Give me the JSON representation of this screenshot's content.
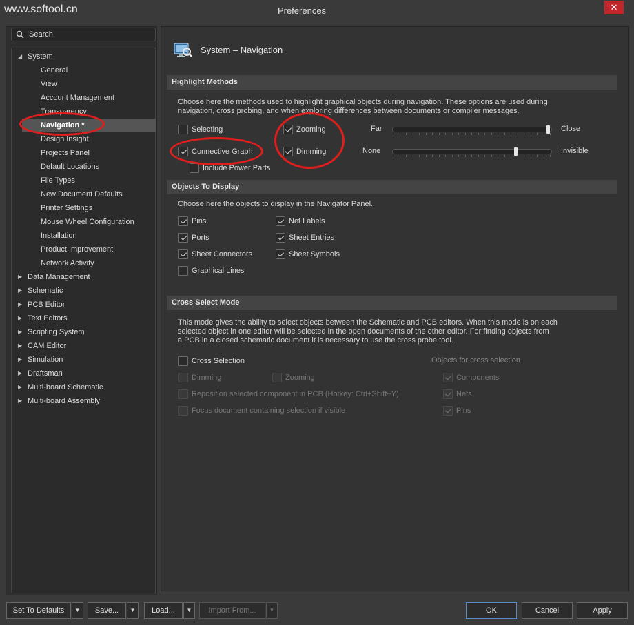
{
  "watermark": "www.softool.cn",
  "window": {
    "title": "Preferences",
    "close_glyph": "✕"
  },
  "search": {
    "placeholder": "Search"
  },
  "tree": {
    "system": "System",
    "children": [
      "General",
      "View",
      "Account Management",
      "Transparency",
      "Navigation *",
      "Design Insight",
      "Projects Panel",
      "Default Locations",
      "File Types",
      "New Document Defaults",
      "Printer Settings",
      "Mouse Wheel Configuration",
      "Installation",
      "Product Improvement",
      "Network Activity"
    ],
    "top_items": [
      "Data Management",
      "Schematic",
      "PCB Editor",
      "Text Editors",
      "Scripting System",
      "CAM Editor",
      "Simulation",
      "Draftsman",
      "Multi-board Schematic",
      "Multi-board Assembly"
    ],
    "selected": "Navigation *"
  },
  "page": {
    "title": "System – Navigation"
  },
  "highlight": {
    "heading": "Highlight Methods",
    "desc_line1": "Choose here the methods used to highlight graphical objects during navigation. These options are used during",
    "desc_line2": "navigation, cross probing, and when exploring differences between documents or compiler messages.",
    "selecting": "Selecting",
    "connective_graph": "Connective Graph",
    "include_power_parts": "Include Power Parts",
    "zooming": "Zooming",
    "dimming": "Dimming",
    "zoom_min": "Far",
    "zoom_max": "Close",
    "zoom_level": 0.99,
    "dim_min": "None",
    "dim_max": "Invisible",
    "dim_level": 0.78
  },
  "objects": {
    "heading": "Objects To Display",
    "desc": "Choose here the objects to display in the Navigator Panel.",
    "pins": "Pins",
    "ports": "Ports",
    "sheet_connectors": "Sheet Connectors",
    "graphical_lines": "Graphical Lines",
    "net_labels": "Net Labels",
    "sheet_entries": "Sheet Entries",
    "sheet_symbols": "Sheet Symbols"
  },
  "cross": {
    "heading": "Cross Select Mode",
    "desc_line1": "This mode gives the ability to select objects between the Schematic and PCB editors.  When this mode is on each",
    "desc_line2": "selected object in one editor will be selected in the open documents of the other editor.  For finding objects from",
    "desc_line3": "a PCB in a closed schematic document it is necessary to use the cross probe tool.",
    "cross_selection": "Cross Selection",
    "dimming": "Dimming",
    "zooming": "Zooming",
    "reposition": "Reposition selected component in PCB (Hotkey: Ctrl+Shift+Y)",
    "focus": "Focus document containing selection if visible",
    "objects_heading": "Objects for cross selection",
    "components": "Components",
    "nets": "Nets",
    "pins": "Pins"
  },
  "buttons": {
    "set_defaults": "Set To Defaults",
    "save": "Save...",
    "load": "Load...",
    "import_from": "Import From...",
    "ok": "OK",
    "cancel": "Cancel",
    "apply": "Apply"
  },
  "colors": {
    "accent": "#5a8ac8",
    "close": "#c0262b",
    "annotation": "#e01e1e"
  }
}
